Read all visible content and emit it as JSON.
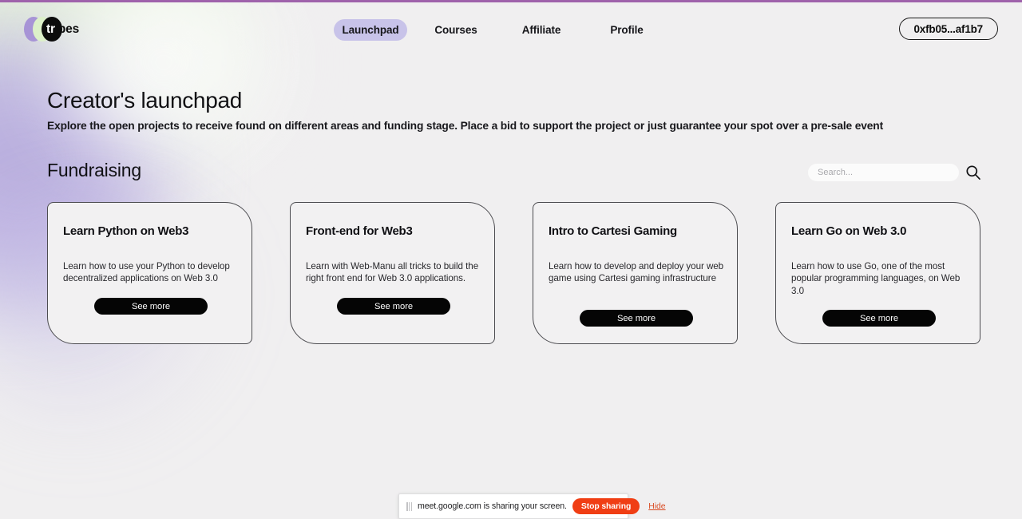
{
  "theme": {
    "page_background": "#f0eff0",
    "top_rule_color": "#9f62ab",
    "accent_lavender": "#c8c3e9",
    "blob_green": "#dcf0c9",
    "blob_purple": "#a794d6",
    "card_background": "#f2f1f2",
    "card_border": "#4c4c50",
    "cta_background": "#050505",
    "cta_text": "#fdfdfd",
    "stop_sharing_background": "#f03e14",
    "hide_link_color": "#d94a22"
  },
  "header": {
    "logo": {
      "wordmark_prefix": "tr",
      "wordmark_suffix": "ibes",
      "wordmark_full": "tribes",
      "ellipse_colors": [
        "#a794d6",
        "#dcf0c9",
        "#0c0c0c"
      ]
    },
    "nav": [
      {
        "label": "Launchpad",
        "active": true
      },
      {
        "label": "Courses",
        "active": false
      },
      {
        "label": "Affiliate",
        "active": false
      },
      {
        "label": "Profile",
        "active": false
      }
    ],
    "wallet": {
      "label": "0xfb05...af1b7"
    }
  },
  "page": {
    "title": "Creator's launchpad",
    "subtitle": "Explore the open projects to receive found on different areas and funding stage. Place a bid to support the project or just guarantee your spot over a pre-sale event"
  },
  "section": {
    "title": "Fundraising",
    "search": {
      "placeholder": "Search...",
      "value": "",
      "icon": "search-icon"
    }
  },
  "cards": [
    {
      "title": "Learn Python on Web3",
      "description": "Learn how to use your Python to develop decentralized applications on Web 3.0",
      "cta_label": "See more",
      "desc_lines": 2
    },
    {
      "title": "Front-end for Web3",
      "description": "Learn with Web-Manu all tricks to build the right front end for Web 3.0 applications.",
      "cta_label": "See more",
      "desc_lines": 2
    },
    {
      "title": "Intro to Cartesi Gaming",
      "description": "Learn how to develop and deploy your web game using Cartesi gaming infrastructure",
      "cta_label": "See more",
      "desc_lines": 3
    },
    {
      "title": "Learn Go on Web 3.0",
      "description": "Learn how to use Go, one of the most popular programming languages, on Web 3.0",
      "cta_label": "See more",
      "desc_lines": 3
    }
  ],
  "share_notification": {
    "message": "meet.google.com is sharing your screen.",
    "stop_label": "Stop sharing",
    "hide_label": "Hide",
    "grip_icon": "drag-grip-icon"
  }
}
